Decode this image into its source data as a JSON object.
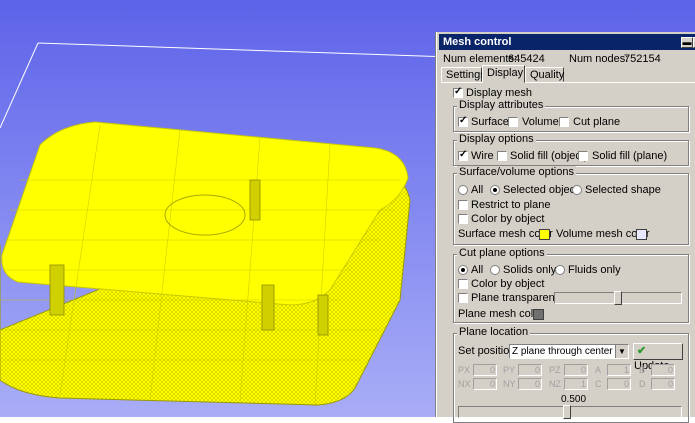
{
  "window": {
    "title": "Mesh control"
  },
  "stats": {
    "elements_label": "Num elements:",
    "elements_value": "645424",
    "nodes_label": "Num nodes:",
    "nodes_value": "752154"
  },
  "tabs": [
    {
      "label": "Settings"
    },
    {
      "label": "Display"
    },
    {
      "label": "Quality"
    }
  ],
  "display": {
    "display_mesh": "Display mesh",
    "attributes": {
      "title": "Display attributes",
      "surface": "Surface",
      "volume": "Volume",
      "cut_plane": "Cut plane"
    },
    "options": {
      "title": "Display options",
      "wire": "Wire",
      "solid_object": "Solid fill (object)",
      "solid_plane": "Solid fill (plane)"
    },
    "surfvol": {
      "title": "Surface/volume options",
      "all": "All",
      "selected_object": "Selected object",
      "selected_shape": "Selected shape",
      "restrict": "Restrict to plane",
      "color_by_object": "Color by object",
      "surface_color_label": "Surface mesh color",
      "volume_color_label": "Volume mesh color"
    },
    "cutplane": {
      "title": "Cut plane options",
      "all": "All",
      "solids_only": "Solids only",
      "fluids_only": "Fluids only",
      "color_by_object": "Color by object",
      "transparency": "Plane transparency",
      "transparency_level": 0.5,
      "plane_color_label": "Plane mesh color"
    },
    "location": {
      "title": "Plane location",
      "set_position_label": "Set position",
      "set_position_value": "Z plane through center",
      "update_label": "Update",
      "fields": [
        {
          "label": "PX",
          "value": "0"
        },
        {
          "label": "PY",
          "value": "0"
        },
        {
          "label": "PZ",
          "value": "0"
        },
        {
          "label": "A",
          "value": "1"
        },
        {
          "label": "B",
          "value": "0"
        },
        {
          "label": "NX",
          "value": "0"
        },
        {
          "label": "NY",
          "value": "0"
        },
        {
          "label": "NZ",
          "value": "1"
        },
        {
          "label": "C",
          "value": "0"
        },
        {
          "label": "D",
          "value": "0"
        }
      ],
      "slider_value": "0.500"
    }
  },
  "colors": {
    "surface_mesh": "#ffff00",
    "volume_mesh": "#e8e8ff",
    "plane_mesh": "#707070",
    "model": "#ffff00",
    "update_check": "#2c9a2c"
  }
}
